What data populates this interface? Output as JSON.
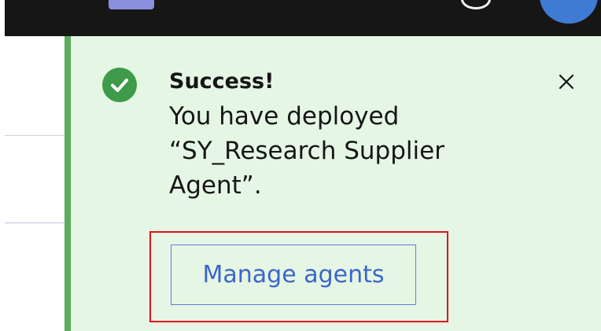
{
  "notification": {
    "title": "Success!",
    "message": "You have deployed\n“SY_Research Supplier\nAgent”.",
    "action_label": "Manage agents",
    "status_icon": "checkmark-filled-icon",
    "close_icon": "close-icon"
  },
  "colors": {
    "header_background": "#161616",
    "toast_background": "#e6f6e5",
    "toast_accent": "#5bae5e",
    "success_icon": "#3d9b4a",
    "button_text": "#3b66c9",
    "highlight": "#e0101a"
  }
}
